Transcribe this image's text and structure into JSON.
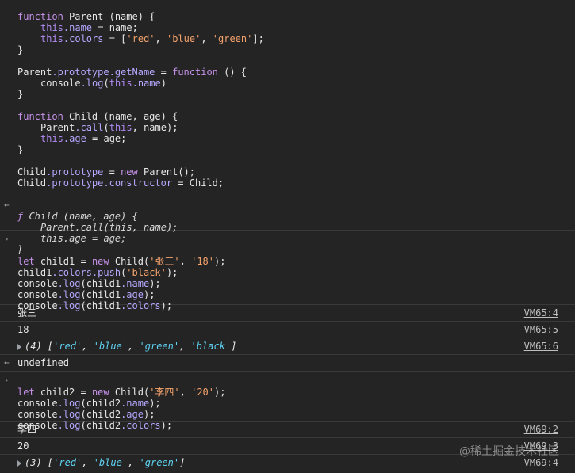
{
  "entry1": {
    "lines": [
      "function Parent (name) {",
      "this.name = name;",
      "this.colors = ['red', 'blue', 'green'];",
      "}",
      "Parent.prototype.getName = function () {",
      "console.log(this.name)",
      "}",
      "function Child (name, age) {",
      "Parent.call(this, name);",
      "this.age = age;",
      "}",
      "Child.prototype = new Parent();",
      "Child.prototype.constructor = Child;"
    ],
    "result_lines": [
      "ƒ Child (name, age) {",
      "Parent.call(this, name);",
      "this.age = age;",
      "}"
    ]
  },
  "entry2": {
    "lines": [
      "let child1 = new Child('张三', '18');",
      "child1.colors.push('black');",
      "console.log(child1.name);",
      "console.log(child1.age);",
      "console.log(child1.colors);"
    ],
    "logs": [
      {
        "text": "张三",
        "source": "VM65:4"
      },
      {
        "text": "18",
        "source": "VM65:5"
      },
      {
        "text": "(4) ['red', 'blue', 'green', 'black']",
        "source": "VM65:6"
      }
    ],
    "result": "undefined"
  },
  "entry3": {
    "lines": [
      "let child2 = new Child('李四', '20');",
      "console.log(child2.name);",
      "console.log(child2.age);",
      "console.log(child2.colors);"
    ],
    "logs": [
      {
        "text": "李四",
        "source": "VM69:2"
      },
      {
        "text": "20",
        "source": "VM69:3"
      },
      {
        "text": "(3) ['red', 'blue', 'green']",
        "source": "VM69:4"
      }
    ]
  },
  "watermark": "@稀土掘金技术社区",
  "icons": {
    "input_prompt": "chevron-right-icon",
    "result_prompt": "return-arrow-icon",
    "expand": "triangle-right-icon"
  }
}
